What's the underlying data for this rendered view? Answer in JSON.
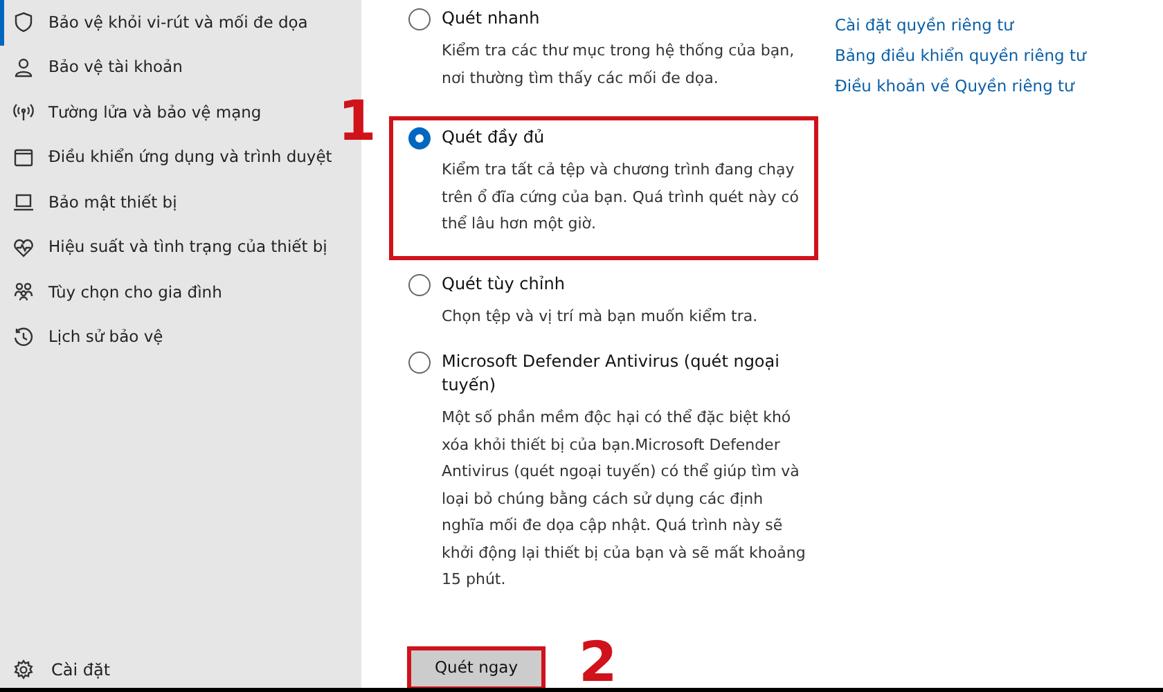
{
  "sidebar": {
    "items": [
      {
        "label": "Bảo vệ khỏi vi-rút và mối đe dọa",
        "selected": true
      },
      {
        "label": "Bảo vệ tài khoản",
        "selected": false
      },
      {
        "label": "Tường lửa và bảo vệ mạng",
        "selected": false
      },
      {
        "label": "Điều khiển ứng dụng và trình duyệt",
        "selected": false
      },
      {
        "label": "Bảo mật thiết bị",
        "selected": false
      },
      {
        "label": "Hiệu suất và tình trạng của thiết bị",
        "selected": false
      },
      {
        "label": "Tùy chọn cho gia đình",
        "selected": false
      },
      {
        "label": "Lịch sử bảo vệ",
        "selected": false
      }
    ],
    "settings": {
      "label": "Cài đặt"
    }
  },
  "scan_options": [
    {
      "label": "Quét nhanh",
      "description": "Kiểm tra các thư mục trong hệ thống của bạn, nơi thường tìm thấy các mối đe dọa.",
      "selected": false,
      "highlighted": false
    },
    {
      "label": "Quét đầy đủ",
      "description": "Kiểm tra tất cả tệp và chương trình đang chạy trên ổ đĩa cứng của bạn. Quá trình quét này có thể lâu hơn một giờ.",
      "selected": true,
      "highlighted": true
    },
    {
      "label": "Quét tùy chỉnh",
      "description": "Chọn tệp và vị trí mà bạn muốn kiểm tra.",
      "selected": false,
      "highlighted": false
    },
    {
      "label": "Microsoft Defender Antivirus (quét ngoại tuyến)",
      "description": "Một số phần mềm độc hại có thể đặc biệt khó xóa khỏi thiết bị của bạn.Microsoft Defender Antivirus (quét ngoại tuyến) có thể giúp tìm và loại bỏ chúng bằng cách sử dụng các định nghĩa mối đe dọa cập nhật. Quá trình này sẽ khởi động lại thiết bị của bạn và sẽ mất khoảng 15 phút.",
      "selected": false,
      "highlighted": false
    }
  ],
  "scan_button": {
    "label": "Quét ngay",
    "highlighted": true
  },
  "annotations": [
    "1",
    "2"
  ],
  "links": [
    "Cài đặt quyền riêng tư",
    "Bảng điều khiển quyền riêng tư",
    "Điều khoản về Quyền riêng tư"
  ]
}
